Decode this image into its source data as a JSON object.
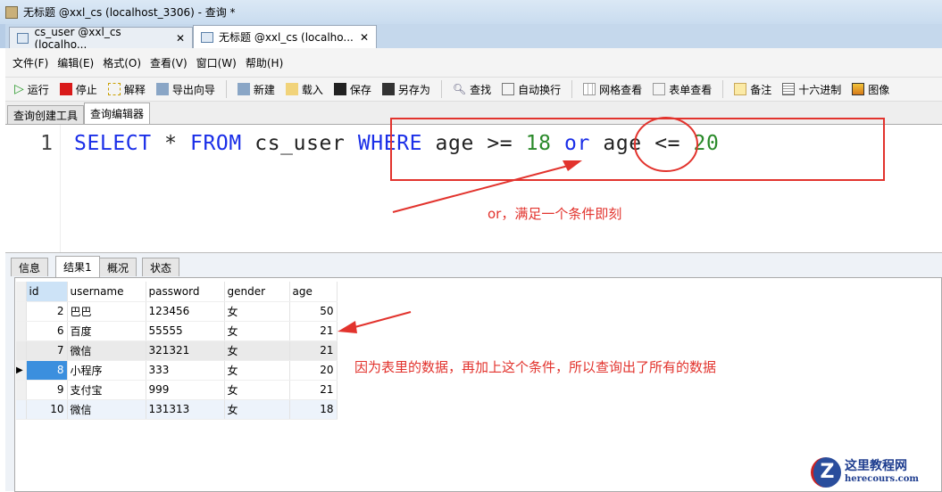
{
  "window": {
    "title": "无标题 @xxl_cs (localhost_3306) - 查询 *"
  },
  "doc_tabs": [
    {
      "label": "cs_user @xxl_cs (localho..."
    },
    {
      "label": "无标题 @xxl_cs (localho..."
    }
  ],
  "menu": [
    "文件(F)",
    "编辑(E)",
    "格式(O)",
    "查看(V)",
    "窗口(W)",
    "帮助(H)"
  ],
  "toolbar": [
    "运行",
    "停止",
    "解释",
    "导出向导",
    "新建",
    "载入",
    "保存",
    "另存为",
    "查找",
    "自动换行",
    "网格查看",
    "表单查看",
    "备注",
    "十六进制",
    "图像"
  ],
  "sub_tabs": [
    "查询创建工具",
    "查询编辑器"
  ],
  "editor": {
    "line_number": "1",
    "tokens": [
      "SELECT",
      " * ",
      "FROM",
      " cs_user ",
      "WHERE",
      " age >= ",
      "18",
      " ",
      "or",
      " age <= ",
      "20"
    ]
  },
  "result_tabs": [
    "信息",
    "结果1",
    "概况",
    "状态"
  ],
  "grid": {
    "columns": [
      "id",
      "username",
      "password",
      "gender",
      "age"
    ],
    "rows": [
      [
        "2",
        "巴巴",
        "123456",
        "女",
        "50"
      ],
      [
        "6",
        "百度",
        "55555",
        "女",
        "21"
      ],
      [
        "7",
        "微信",
        "321321",
        "女",
        "21"
      ],
      [
        "8",
        "小程序",
        "333",
        "女",
        "20"
      ],
      [
        "9",
        "支付宝",
        "999",
        "女",
        "21"
      ],
      [
        "10",
        "微信",
        "131313",
        "女",
        "18"
      ]
    ]
  },
  "annotations": {
    "note1": "or，满足一个条件即刻",
    "note2": "因为表里的数据，再加上这个条件，所以查询出了所有的数据",
    "color": "#e2332d"
  },
  "watermark": {
    "name": "这里教程网",
    "url": "herecours.com"
  }
}
